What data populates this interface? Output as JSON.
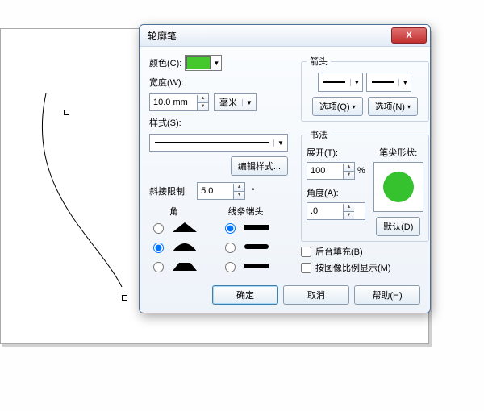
{
  "dialog": {
    "title": "轮廓笔",
    "close_glyph": "X",
    "color_label": "颜色(C):",
    "width_label": "宽度(W):",
    "width_value": "10.0 mm",
    "unit_value": "毫米",
    "style_label": "样式(S):",
    "edit_style_btn": "编辑样式...",
    "miter_label": "斜接限制:",
    "miter_value": "5.0",
    "corner_label": "角",
    "cap_label": "线条端头",
    "arrow_group": "箭头",
    "options_left": "选项(Q)",
    "options_right": "选项(N)",
    "calligraphy_group": "书法",
    "spread_label": "展开(T):",
    "spread_value": "100",
    "spread_pct": "%",
    "angle_label": "角度(A):",
    "angle_value": ".0",
    "nib_label": "笔尖形状:",
    "default_btn": "默认(D)",
    "behind_fill": "后台填充(B)",
    "scale_with_image": "按图像比例显示(M)",
    "ok": "确定",
    "cancel": "取消",
    "help": "帮助(H)"
  }
}
